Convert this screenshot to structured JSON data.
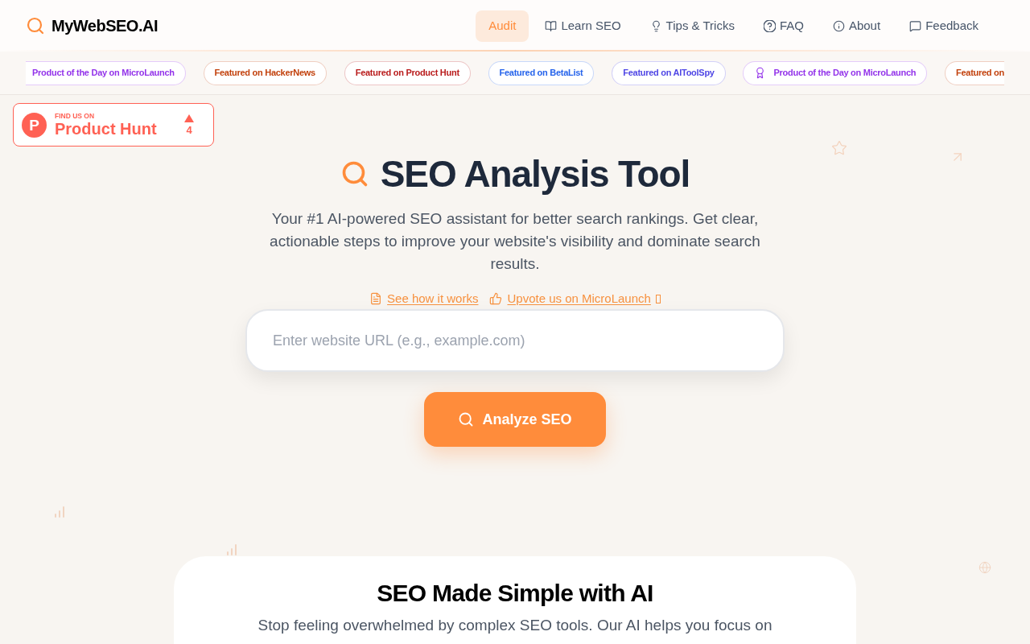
{
  "header": {
    "logo": "MyWebSEO.AI",
    "nav": [
      {
        "label": "Audit",
        "selected": true
      },
      {
        "label": "Learn SEO",
        "selected": false
      },
      {
        "label": "Tips & Tricks",
        "selected": false
      },
      {
        "label": "FAQ",
        "selected": false
      },
      {
        "label": "About",
        "selected": false
      },
      {
        "label": "Feedback",
        "selected": false
      }
    ]
  },
  "badges": [
    {
      "label": "Product of the Day on MicroLaunch",
      "kind": "featured",
      "color": "#9333ea"
    },
    {
      "label": "Featured on HackerNews",
      "kind": "featured",
      "color": "#c2410c"
    },
    {
      "label": "Featured on Product Hunt",
      "kind": "featured",
      "color": "#b91c1c"
    },
    {
      "label": "Featured on BetaList",
      "kind": "featured",
      "color": "#2563eb"
    },
    {
      "label": "Featured on AIToolSpy",
      "kind": "featured",
      "color": "#4f46e5"
    },
    {
      "label": "Product of the Day on MicroLaunch",
      "kind": "award",
      "color": "#9333ea"
    },
    {
      "label": "Featured on",
      "kind": "featured",
      "color": "#c2410c"
    }
  ],
  "product_hunt": {
    "logo": "P",
    "eyebrow": "FIND US ON",
    "name": "Product Hunt",
    "votes": "4"
  },
  "hero": {
    "title": "SEO Analysis Tool",
    "subtitle": "Your #1 AI-powered SEO assistant for better search rankings. Get clear, actionable steps to improve your website's visibility and dominate search results.",
    "links": [
      {
        "label": "See how it works"
      },
      {
        "label": "Upvote us on MicroLaunch"
      }
    ]
  },
  "search": {
    "placeholder": "Enter website URL (e.g., example.com)",
    "button": "Analyze SEO"
  },
  "section": {
    "title": "SEO Made Simple with AI",
    "text": "Stop feeling overwhelmed by complex SEO tools. Our AI helps you focus on"
  }
}
